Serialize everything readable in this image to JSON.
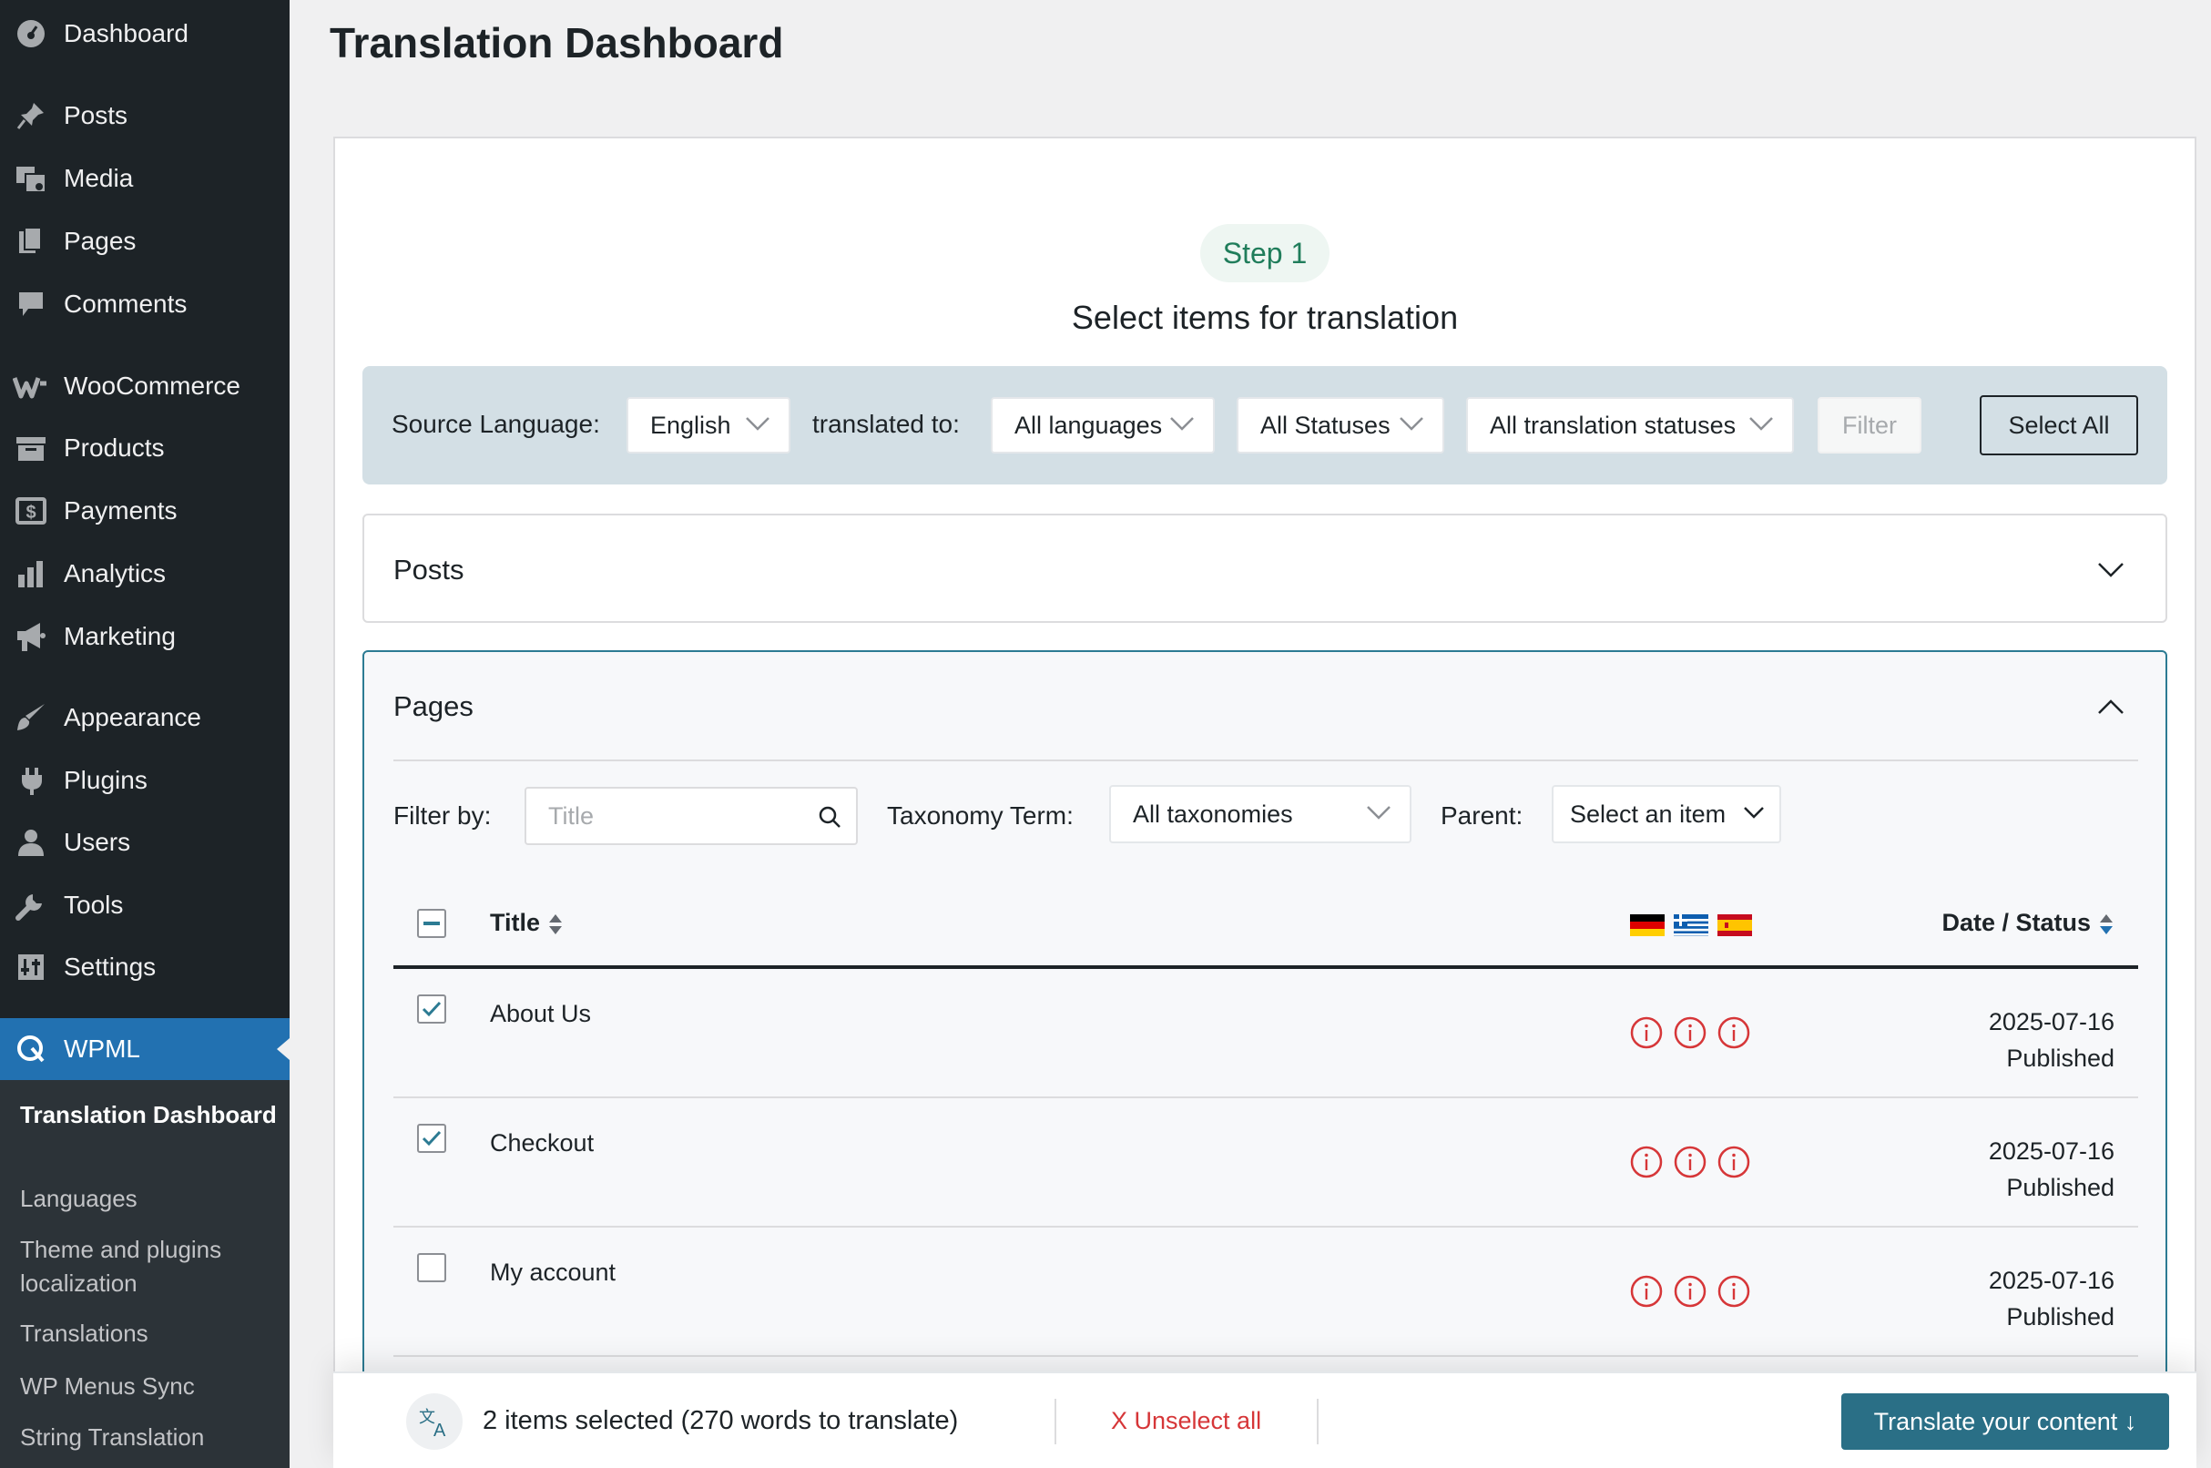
{
  "page": {
    "title": "Translation Dashboard"
  },
  "sidebar": {
    "items": [
      {
        "label": "Dashboard",
        "icon": "dashboard-icon"
      },
      {
        "label": "Posts",
        "icon": "pin-icon"
      },
      {
        "label": "Media",
        "icon": "media-icon"
      },
      {
        "label": "Pages",
        "icon": "pages-icon"
      },
      {
        "label": "Comments",
        "icon": "comment-icon"
      },
      {
        "label": "WooCommerce",
        "icon": "woocommerce-icon"
      },
      {
        "label": "Products",
        "icon": "archive-icon"
      },
      {
        "label": "Payments",
        "icon": "payments-icon"
      },
      {
        "label": "Analytics",
        "icon": "bar-chart-icon"
      },
      {
        "label": "Marketing",
        "icon": "megaphone-icon"
      },
      {
        "label": "Appearance",
        "icon": "brush-icon"
      },
      {
        "label": "Plugins",
        "icon": "plugin-icon"
      },
      {
        "label": "Users",
        "icon": "user-icon"
      },
      {
        "label": "Tools",
        "icon": "wrench-icon"
      },
      {
        "label": "Settings",
        "icon": "sliders-icon"
      },
      {
        "label": "WPML",
        "icon": "wpml-icon",
        "active": true
      }
    ],
    "submenu": [
      {
        "label": "Translation Dashboard",
        "current": true
      },
      {
        "label": "Languages"
      },
      {
        "label": "Theme and plugins localization"
      },
      {
        "label": "Translations"
      },
      {
        "label": "WP Menus Sync"
      },
      {
        "label": "String Translation"
      }
    ]
  },
  "step": {
    "pill": "Step 1",
    "heading": "Select items for translation"
  },
  "filters": {
    "source_label": "Source Language:",
    "source_value": "English",
    "translated_label": "translated to:",
    "translated_value": "All languages",
    "status_value": "All Statuses",
    "translation_status_value": "All translation statuses",
    "filter_button": "Filter",
    "select_all_button": "Select All"
  },
  "sections": {
    "posts": {
      "title": "Posts",
      "expanded": false
    },
    "pages": {
      "title": "Pages",
      "expanded": true,
      "filter_by_label": "Filter by:",
      "title_placeholder": "Title",
      "taxonomy_label": "Taxonomy Term:",
      "taxonomy_value": "All taxonomies",
      "parent_label": "Parent:",
      "parent_value": "Select an item"
    }
  },
  "table": {
    "columns": {
      "title": "Title",
      "date_status": "Date / Status"
    },
    "languages": [
      "de",
      "el",
      "es"
    ],
    "rows": [
      {
        "title": "About Us",
        "checked": true,
        "date": "2025-07-16",
        "status": "Published"
      },
      {
        "title": "Checkout",
        "checked": true,
        "date": "2025-07-16",
        "status": "Published"
      },
      {
        "title": "My account",
        "checked": false,
        "date": "2025-07-16",
        "status": "Published"
      }
    ]
  },
  "bottom_bar": {
    "selection_text": "2 items selected (270 words to translate)",
    "unselect_label": "X Unselect all",
    "translate_button": "Translate your content ↓"
  },
  "colors": {
    "sidebar_bg": "#1d2327",
    "active_blue": "#2271b1",
    "accent_teal": "#2a6f86",
    "step_green": "#207d5b",
    "needs_translation": "#d63638"
  }
}
